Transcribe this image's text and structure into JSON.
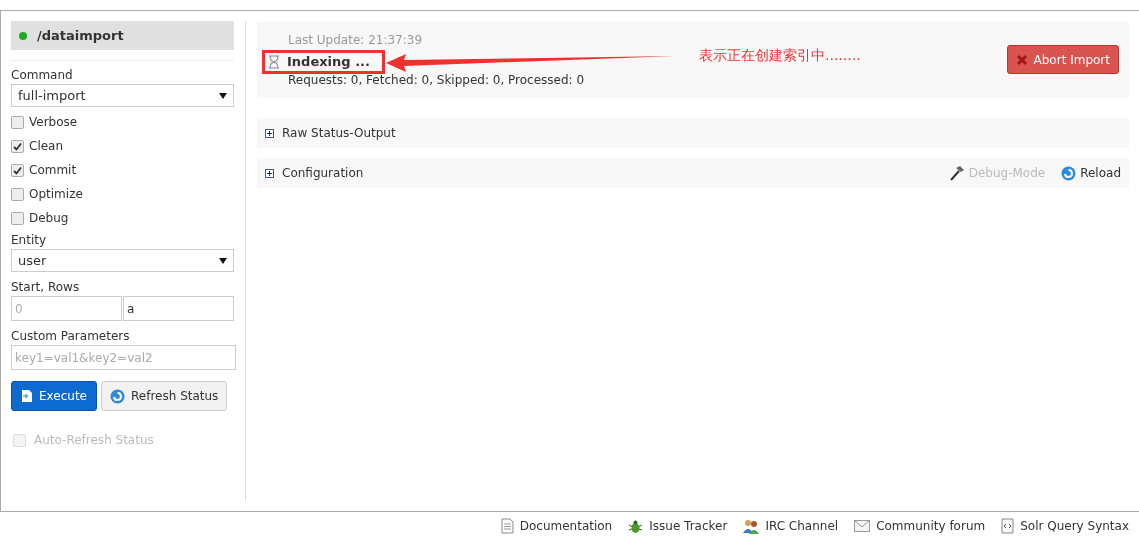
{
  "sidebar": {
    "title": "/dataimport",
    "command": {
      "label": "Command",
      "value": "full-import"
    },
    "options": [
      {
        "label": "Verbose",
        "checked": false
      },
      {
        "label": "Clean",
        "checked": true
      },
      {
        "label": "Commit",
        "checked": true
      },
      {
        "label": "Optimize",
        "checked": false
      },
      {
        "label": "Debug",
        "checked": false
      }
    ],
    "entity": {
      "label": "Entity",
      "value": "user"
    },
    "start_rows": {
      "label": "Start, Rows",
      "start_placeholder": "0",
      "rows_value": "a"
    },
    "custom_parameters": {
      "label": "Custom Parameters",
      "placeholder": "key1=val1&key2=val2"
    },
    "execute_button": "Execute",
    "refresh_button": "Refresh Status",
    "auto_refresh": {
      "label": "Auto-Refresh Status",
      "checked": false,
      "disabled": true
    }
  },
  "status": {
    "last_update": "Last Update: 21:37:39",
    "state": "Indexing ...",
    "counts": "Requests: 0, Fetched: 0, Skipped: 0, Processed: 0",
    "abort_button": "Abort Import"
  },
  "annotation": {
    "text": "表示正在创建索引中........"
  },
  "sections": [
    {
      "title": "Raw Status-Output",
      "expanded": false
    },
    {
      "title": "Configuration",
      "expanded": false,
      "debug_mode": "Debug-Mode",
      "reload": "Reload"
    }
  ],
  "footer": [
    "Documentation",
    "Issue Tracker",
    "IRC Channel",
    "Community forum",
    "Solr Query Syntax"
  ]
}
